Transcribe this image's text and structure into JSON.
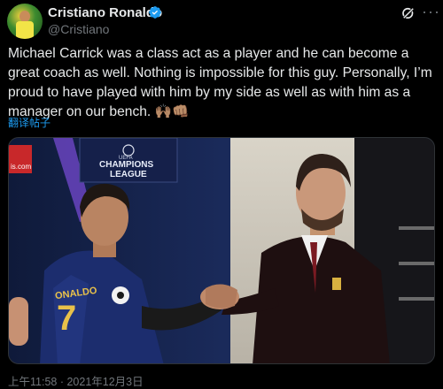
{
  "author": {
    "display_name": "Cristiano Ronaldo",
    "handle": "@Cristiano",
    "verified": true,
    "verified_color": "#1d9bf0"
  },
  "tweet": {
    "text": "Michael Carrick was a class act as a player and he can become a great coach as well. Nothing is impossible for this guy. Personally, I’m proud to have played with him by my side as well as with him as a manager on our bench. 🙌🏽👊🏽",
    "translate_label": "翻译帖子",
    "timestamp": "上午11:58 · 2021年12月3日"
  },
  "media": {
    "board_text_line1": "CHAMPIONS",
    "board_text_line2": "LEAGUE",
    "board_small": "UEFA",
    "jersey_name": "ONALDO",
    "jersey_number": "7",
    "ad_text": "is.com"
  },
  "icons": [
    "grok-icon",
    "more-icon",
    "verified-badge-icon"
  ],
  "colors": {
    "background": "#000000",
    "text": "#e7e9ea",
    "secondary": "#71767b",
    "link": "#1d9bf0"
  }
}
